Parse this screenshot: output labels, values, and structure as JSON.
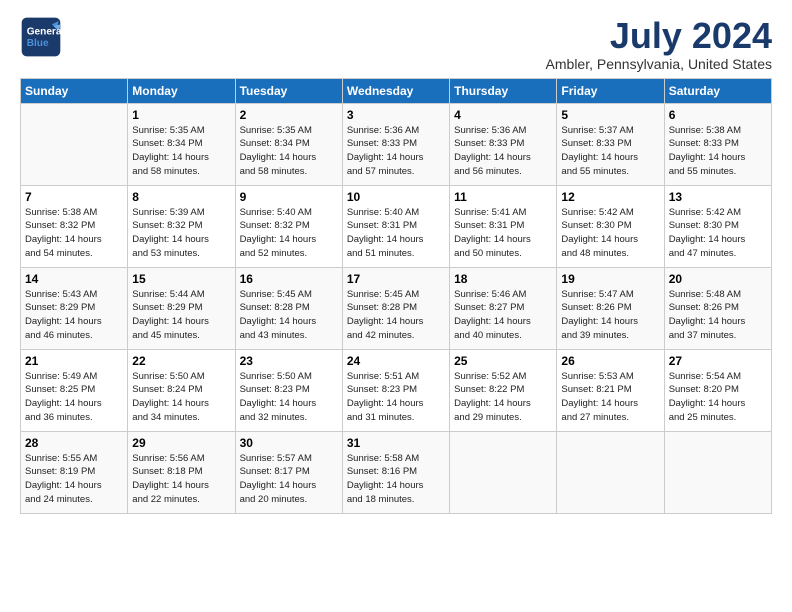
{
  "header": {
    "logo_general": "General",
    "logo_blue": "Blue",
    "title": "July 2024",
    "subtitle": "Ambler, Pennsylvania, United States"
  },
  "weekdays": [
    "Sunday",
    "Monday",
    "Tuesday",
    "Wednesday",
    "Thursday",
    "Friday",
    "Saturday"
  ],
  "weeks": [
    [
      {
        "day": "",
        "info": ""
      },
      {
        "day": "1",
        "info": "Sunrise: 5:35 AM\nSunset: 8:34 PM\nDaylight: 14 hours\nand 58 minutes."
      },
      {
        "day": "2",
        "info": "Sunrise: 5:35 AM\nSunset: 8:34 PM\nDaylight: 14 hours\nand 58 minutes."
      },
      {
        "day": "3",
        "info": "Sunrise: 5:36 AM\nSunset: 8:33 PM\nDaylight: 14 hours\nand 57 minutes."
      },
      {
        "day": "4",
        "info": "Sunrise: 5:36 AM\nSunset: 8:33 PM\nDaylight: 14 hours\nand 56 minutes."
      },
      {
        "day": "5",
        "info": "Sunrise: 5:37 AM\nSunset: 8:33 PM\nDaylight: 14 hours\nand 55 minutes."
      },
      {
        "day": "6",
        "info": "Sunrise: 5:38 AM\nSunset: 8:33 PM\nDaylight: 14 hours\nand 55 minutes."
      }
    ],
    [
      {
        "day": "7",
        "info": "Sunrise: 5:38 AM\nSunset: 8:32 PM\nDaylight: 14 hours\nand 54 minutes."
      },
      {
        "day": "8",
        "info": "Sunrise: 5:39 AM\nSunset: 8:32 PM\nDaylight: 14 hours\nand 53 minutes."
      },
      {
        "day": "9",
        "info": "Sunrise: 5:40 AM\nSunset: 8:32 PM\nDaylight: 14 hours\nand 52 minutes."
      },
      {
        "day": "10",
        "info": "Sunrise: 5:40 AM\nSunset: 8:31 PM\nDaylight: 14 hours\nand 51 minutes."
      },
      {
        "day": "11",
        "info": "Sunrise: 5:41 AM\nSunset: 8:31 PM\nDaylight: 14 hours\nand 50 minutes."
      },
      {
        "day": "12",
        "info": "Sunrise: 5:42 AM\nSunset: 8:30 PM\nDaylight: 14 hours\nand 48 minutes."
      },
      {
        "day": "13",
        "info": "Sunrise: 5:42 AM\nSunset: 8:30 PM\nDaylight: 14 hours\nand 47 minutes."
      }
    ],
    [
      {
        "day": "14",
        "info": "Sunrise: 5:43 AM\nSunset: 8:29 PM\nDaylight: 14 hours\nand 46 minutes."
      },
      {
        "day": "15",
        "info": "Sunrise: 5:44 AM\nSunset: 8:29 PM\nDaylight: 14 hours\nand 45 minutes."
      },
      {
        "day": "16",
        "info": "Sunrise: 5:45 AM\nSunset: 8:28 PM\nDaylight: 14 hours\nand 43 minutes."
      },
      {
        "day": "17",
        "info": "Sunrise: 5:45 AM\nSunset: 8:28 PM\nDaylight: 14 hours\nand 42 minutes."
      },
      {
        "day": "18",
        "info": "Sunrise: 5:46 AM\nSunset: 8:27 PM\nDaylight: 14 hours\nand 40 minutes."
      },
      {
        "day": "19",
        "info": "Sunrise: 5:47 AM\nSunset: 8:26 PM\nDaylight: 14 hours\nand 39 minutes."
      },
      {
        "day": "20",
        "info": "Sunrise: 5:48 AM\nSunset: 8:26 PM\nDaylight: 14 hours\nand 37 minutes."
      }
    ],
    [
      {
        "day": "21",
        "info": "Sunrise: 5:49 AM\nSunset: 8:25 PM\nDaylight: 14 hours\nand 36 minutes."
      },
      {
        "day": "22",
        "info": "Sunrise: 5:50 AM\nSunset: 8:24 PM\nDaylight: 14 hours\nand 34 minutes."
      },
      {
        "day": "23",
        "info": "Sunrise: 5:50 AM\nSunset: 8:23 PM\nDaylight: 14 hours\nand 32 minutes."
      },
      {
        "day": "24",
        "info": "Sunrise: 5:51 AM\nSunset: 8:23 PM\nDaylight: 14 hours\nand 31 minutes."
      },
      {
        "day": "25",
        "info": "Sunrise: 5:52 AM\nSunset: 8:22 PM\nDaylight: 14 hours\nand 29 minutes."
      },
      {
        "day": "26",
        "info": "Sunrise: 5:53 AM\nSunset: 8:21 PM\nDaylight: 14 hours\nand 27 minutes."
      },
      {
        "day": "27",
        "info": "Sunrise: 5:54 AM\nSunset: 8:20 PM\nDaylight: 14 hours\nand 25 minutes."
      }
    ],
    [
      {
        "day": "28",
        "info": "Sunrise: 5:55 AM\nSunset: 8:19 PM\nDaylight: 14 hours\nand 24 minutes."
      },
      {
        "day": "29",
        "info": "Sunrise: 5:56 AM\nSunset: 8:18 PM\nDaylight: 14 hours\nand 22 minutes."
      },
      {
        "day": "30",
        "info": "Sunrise: 5:57 AM\nSunset: 8:17 PM\nDaylight: 14 hours\nand 20 minutes."
      },
      {
        "day": "31",
        "info": "Sunrise: 5:58 AM\nSunset: 8:16 PM\nDaylight: 14 hours\nand 18 minutes."
      },
      {
        "day": "",
        "info": ""
      },
      {
        "day": "",
        "info": ""
      },
      {
        "day": "",
        "info": ""
      }
    ]
  ]
}
